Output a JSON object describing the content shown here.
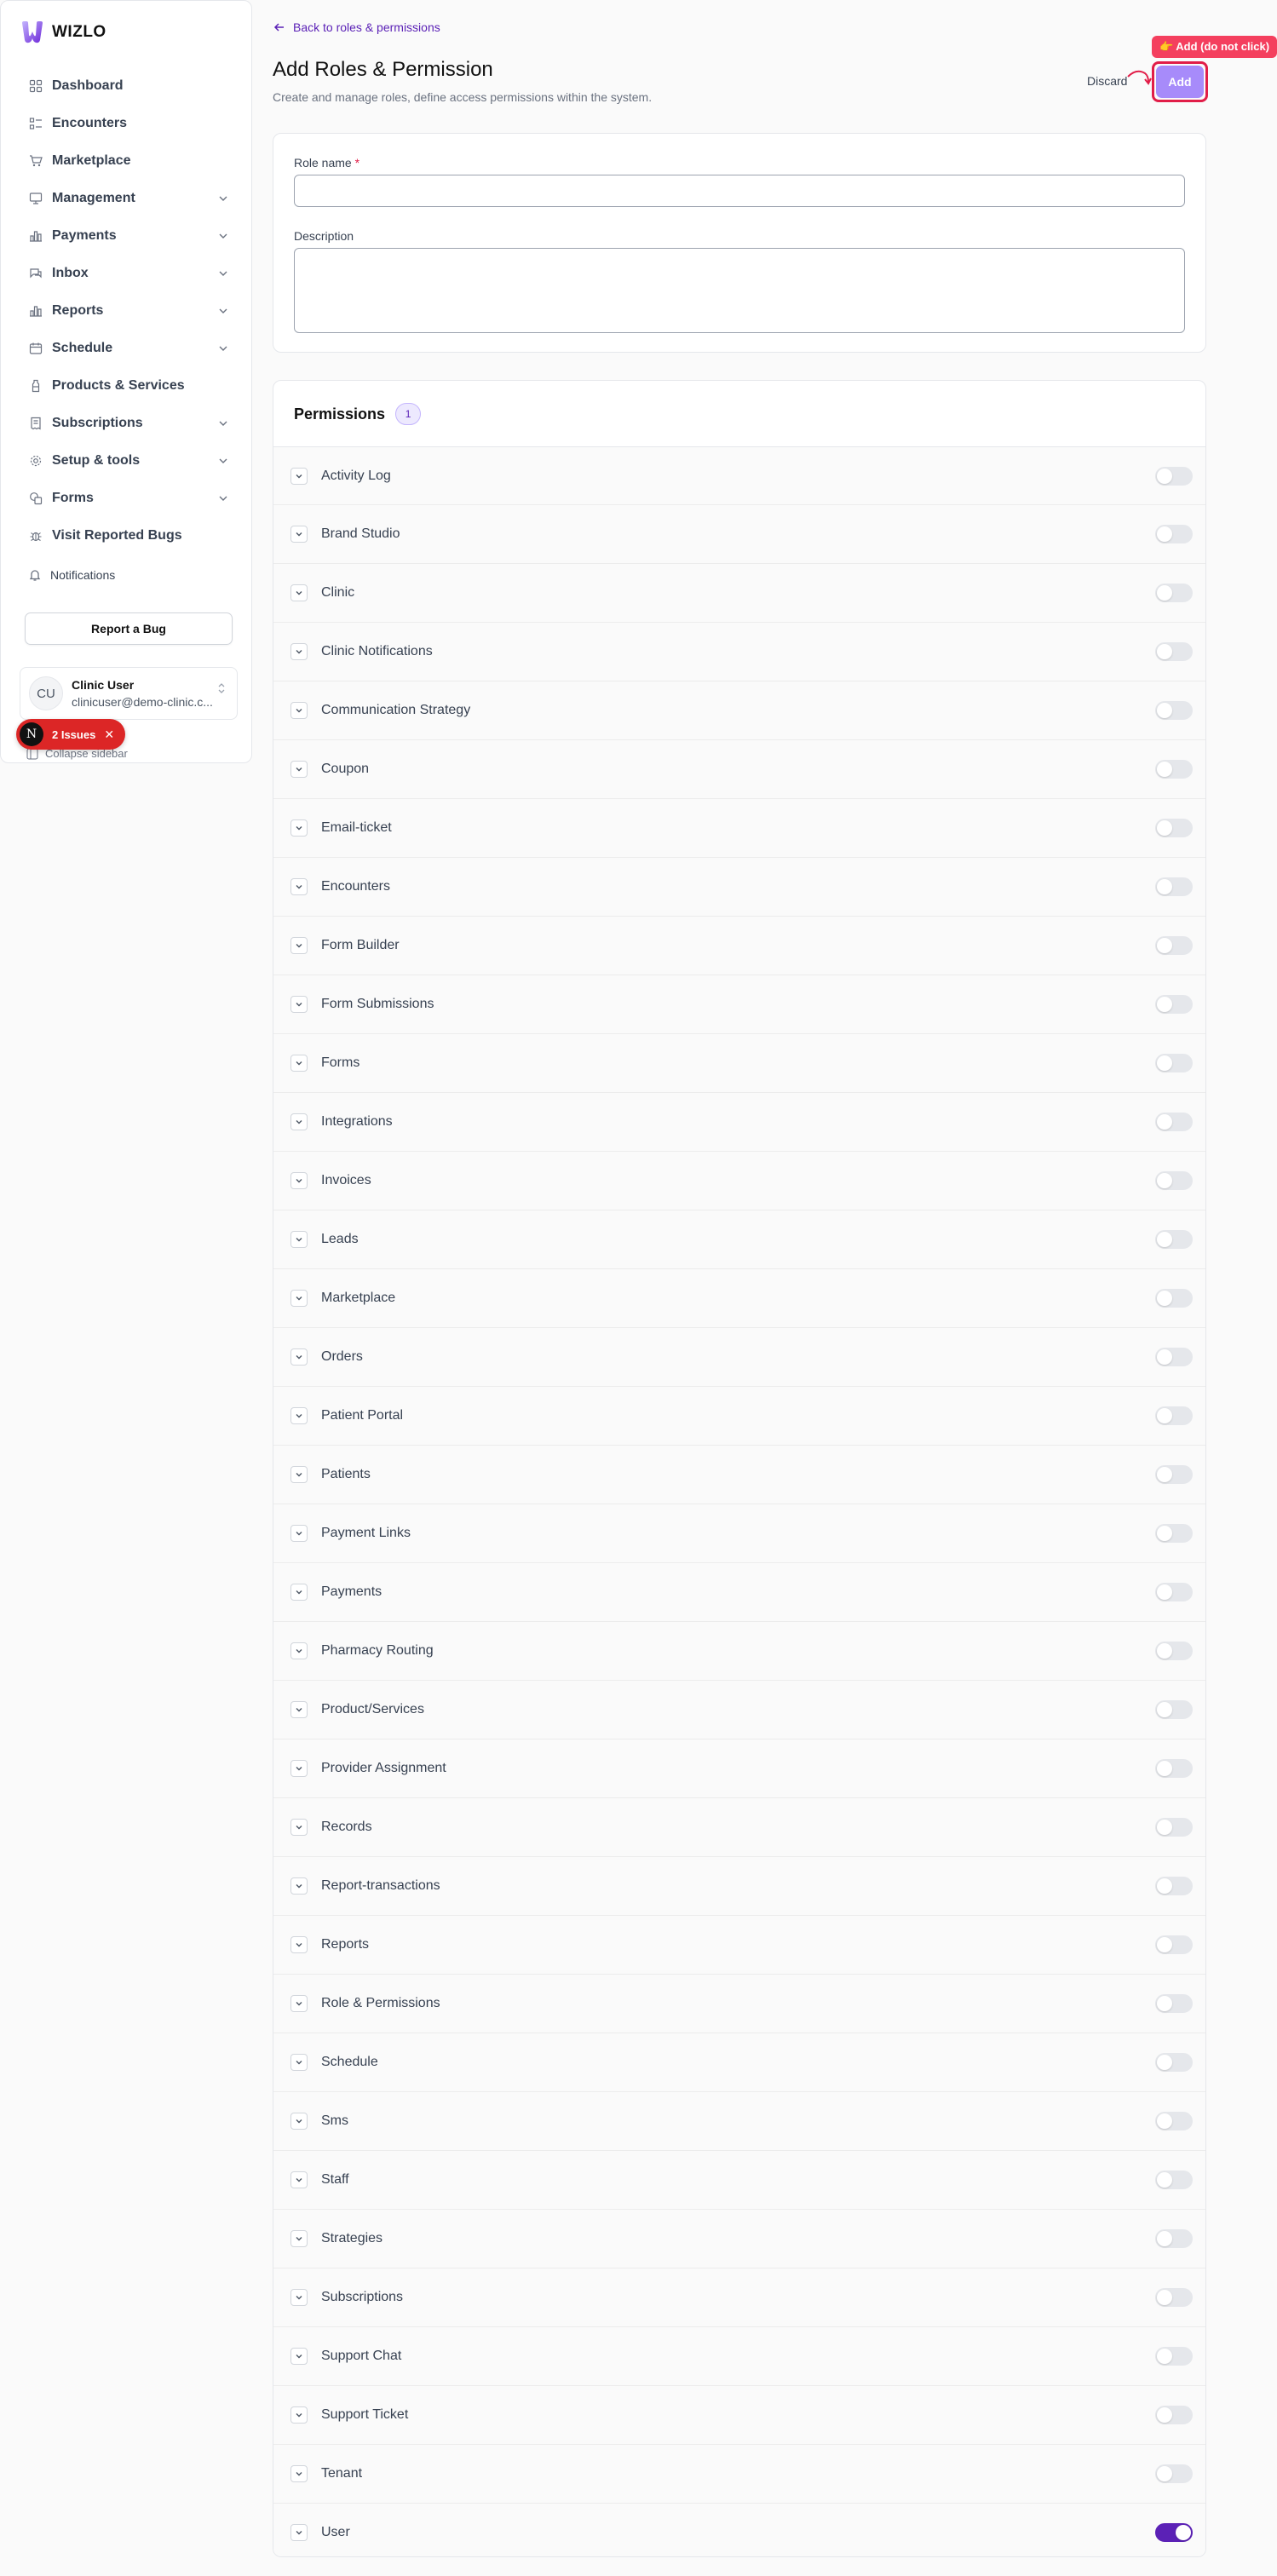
{
  "brand": {
    "name": "WIZLO",
    "accent": "#5b21b6"
  },
  "sidebar": {
    "items": [
      {
        "label": "Dashboard",
        "icon": "dashboard-icon",
        "expandable": false
      },
      {
        "label": "Encounters",
        "icon": "list-icon",
        "expandable": false
      },
      {
        "label": "Marketplace",
        "icon": "cart-icon",
        "expandable": false
      },
      {
        "label": "Management",
        "icon": "monitor-icon",
        "expandable": true
      },
      {
        "label": "Payments",
        "icon": "bar-chart-icon",
        "expandable": true
      },
      {
        "label": "Inbox",
        "icon": "chat-icon",
        "expandable": true
      },
      {
        "label": "Reports",
        "icon": "bar-chart-icon",
        "expandable": true
      },
      {
        "label": "Schedule",
        "icon": "calendar-icon",
        "expandable": true
      },
      {
        "label": "Products & Services",
        "icon": "bottle-icon",
        "expandable": false
      },
      {
        "label": "Subscriptions",
        "icon": "receipt-icon",
        "expandable": true
      },
      {
        "label": "Setup & tools",
        "icon": "gear-icon",
        "expandable": true
      },
      {
        "label": "Forms",
        "icon": "forms-icon",
        "expandable": true
      },
      {
        "label": "Visit Reported Bugs",
        "icon": "bug-icon",
        "expandable": false
      }
    ],
    "notifications_label": "Notifications",
    "report_bug_label": "Report a Bug",
    "user": {
      "initials": "CU",
      "name": "Clinic User",
      "email": "clinicuser@demo-clinic.c..."
    },
    "collapse_label": "Collapse sidebar",
    "issues_badge": {
      "avatar_letter": "N",
      "label": "2 Issues"
    }
  },
  "header": {
    "back_label": "Back to roles & permissions",
    "title": "Add Roles & Permission",
    "subtitle": "Create and manage roles, define access permissions within the system.",
    "discard_label": "Discard",
    "add_label": "Add",
    "tooltip": "👉 Add (do not click)"
  },
  "form": {
    "role_name_label": "Role name",
    "required_mark": "*",
    "role_name_value": "",
    "description_label": "Description",
    "description_value": ""
  },
  "permissions": {
    "title": "Permissions",
    "count": "1",
    "items": [
      {
        "name": "Activity Log",
        "enabled": false
      },
      {
        "name": "Brand Studio",
        "enabled": false
      },
      {
        "name": "Clinic",
        "enabled": false
      },
      {
        "name": "Clinic Notifications",
        "enabled": false
      },
      {
        "name": "Communication Strategy",
        "enabled": false
      },
      {
        "name": "Coupon",
        "enabled": false
      },
      {
        "name": "Email-ticket",
        "enabled": false
      },
      {
        "name": "Encounters",
        "enabled": false
      },
      {
        "name": "Form Builder",
        "enabled": false
      },
      {
        "name": "Form Submissions",
        "enabled": false
      },
      {
        "name": "Forms",
        "enabled": false
      },
      {
        "name": "Integrations",
        "enabled": false
      },
      {
        "name": "Invoices",
        "enabled": false
      },
      {
        "name": "Leads",
        "enabled": false
      },
      {
        "name": "Marketplace",
        "enabled": false
      },
      {
        "name": "Orders",
        "enabled": false
      },
      {
        "name": "Patient Portal",
        "enabled": false
      },
      {
        "name": "Patients",
        "enabled": false
      },
      {
        "name": "Payment Links",
        "enabled": false
      },
      {
        "name": "Payments",
        "enabled": false
      },
      {
        "name": "Pharmacy Routing",
        "enabled": false
      },
      {
        "name": "Product/Services",
        "enabled": false
      },
      {
        "name": "Provider Assignment",
        "enabled": false
      },
      {
        "name": "Records",
        "enabled": false
      },
      {
        "name": "Report-transactions",
        "enabled": false
      },
      {
        "name": "Reports",
        "enabled": false
      },
      {
        "name": "Role & Permissions",
        "enabled": false
      },
      {
        "name": "Schedule",
        "enabled": false
      },
      {
        "name": "Sms",
        "enabled": false
      },
      {
        "name": "Staff",
        "enabled": false
      },
      {
        "name": "Strategies",
        "enabled": false
      },
      {
        "name": "Subscriptions",
        "enabled": false
      },
      {
        "name": "Support Chat",
        "enabled": false
      },
      {
        "name": "Support Ticket",
        "enabled": false
      },
      {
        "name": "Tenant",
        "enabled": false
      },
      {
        "name": "User",
        "enabled": true
      }
    ]
  }
}
